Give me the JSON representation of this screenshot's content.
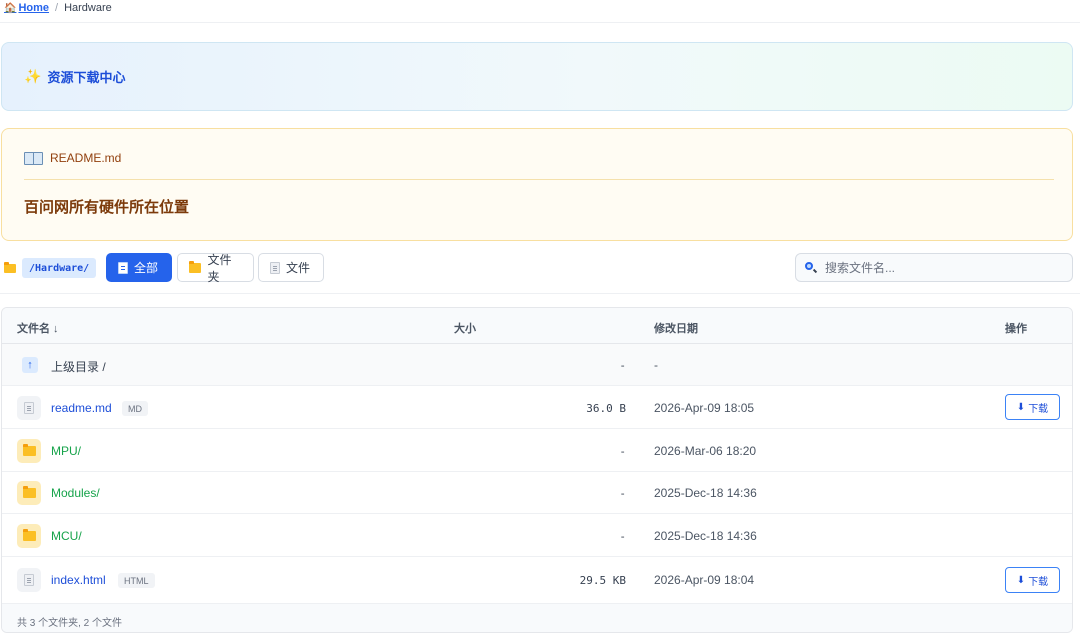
{
  "breadcrumb": {
    "home": "Home",
    "separator": "/",
    "current": "Hardware"
  },
  "hero": {
    "title": "资源下载中心"
  },
  "readme": {
    "filename": "README.md",
    "content": "百问网所有硬件所在位置"
  },
  "toolbar": {
    "path": "/Hardware/",
    "filters": {
      "all": "全部",
      "folders": "文件夹",
      "files": "文件"
    },
    "active_filter": "all",
    "search_placeholder": "搜索文件名..."
  },
  "table": {
    "headers": {
      "name": "文件名 ↓",
      "size": "大小",
      "modified": "修改日期",
      "actions": "操作"
    },
    "parent": {
      "name": "上级目录 /",
      "size": "-",
      "modified": "-"
    },
    "rows": [
      {
        "type": "file",
        "name": "readme.md",
        "ext": "MD",
        "size": "36.0 B",
        "modified": "2026-Apr-09 18:05",
        "action": "下载"
      },
      {
        "type": "folder",
        "name": "MPU/",
        "size": "-",
        "modified": "2026-Mar-06 18:20"
      },
      {
        "type": "folder",
        "name": "Modules/",
        "size": "-",
        "modified": "2025-Dec-18 14:36"
      },
      {
        "type": "folder",
        "name": "MCU/",
        "size": "-",
        "modified": "2025-Dec-18 14:36"
      },
      {
        "type": "file",
        "name": "index.html",
        "ext": "HTML",
        "size": "29.5 KB",
        "modified": "2026-Apr-09 18:04",
        "action": "下载"
      }
    ],
    "footer": "共 3 个文件夹, 2 个文件"
  },
  "colors": {
    "accent": "#2563eb",
    "folder": "#fbbf24",
    "folder_link": "#16a34a",
    "readme_text": "#7c3a0a"
  }
}
